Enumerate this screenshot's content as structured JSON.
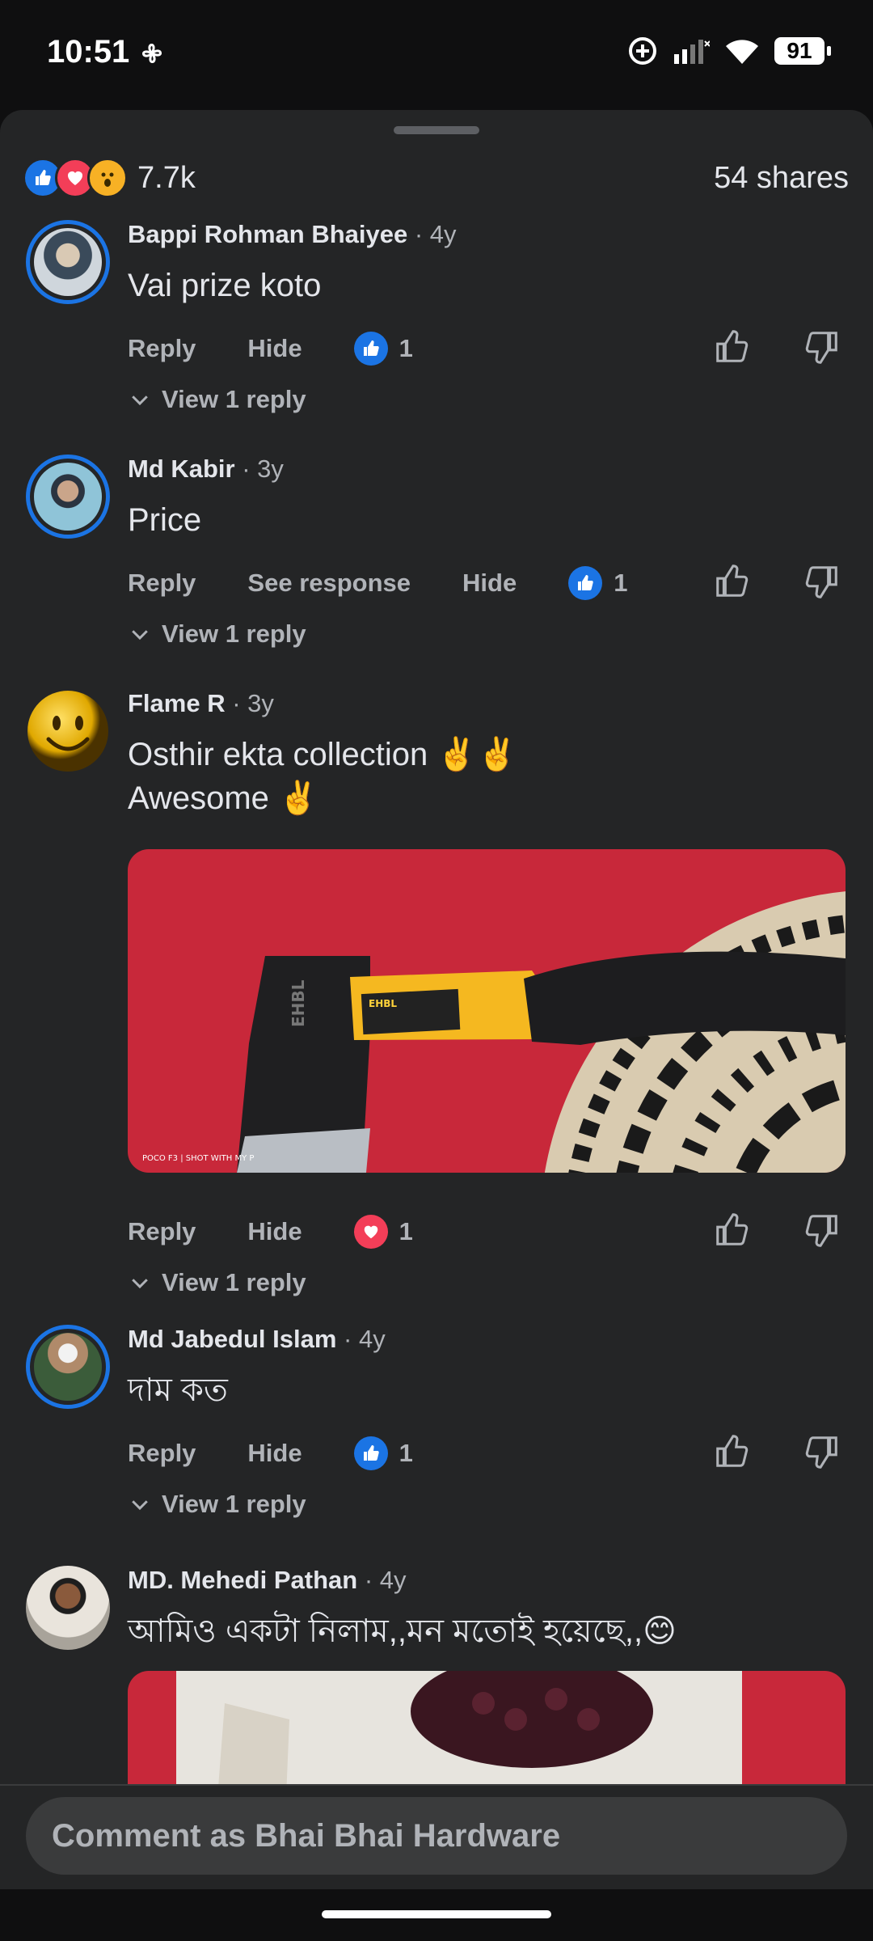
{
  "status_bar": {
    "time": "10:51",
    "battery": "91"
  },
  "summary": {
    "reaction_count": "7.7k",
    "shares": "54 shares",
    "reaction_icons": [
      "like-icon",
      "love-icon",
      "wow-icon"
    ]
  },
  "comments": [
    {
      "name": "Bappi Rohman Bhaiyee",
      "age": "· 4y",
      "text": "Vai prize koto",
      "actions": [
        "Reply",
        "Hide"
      ],
      "reaction": "like",
      "reaction_count": "1",
      "view_replies": "View 1 reply"
    },
    {
      "name": "Md Kabir",
      "age": "· 3y",
      "text": "Price",
      "actions": [
        "Reply",
        "See response",
        "Hide"
      ],
      "reaction": "like",
      "reaction_count": "1",
      "view_replies": "View 1 reply"
    },
    {
      "name": "Flame R",
      "age": "· 3y",
      "text_line1": "Osthir ekta collection ✌️✌️",
      "text_line2": "Awesome ✌️",
      "photo_caption": "POCO F3 | SHOT WITH MY P",
      "axe_brand": "EHBL",
      "actions": [
        "Reply",
        "Hide"
      ],
      "reaction": "love",
      "reaction_count": "1",
      "view_replies": "View 1 reply"
    },
    {
      "name": "Md Jabedul Islam",
      "age": "· 4y",
      "text": "দাম কত",
      "actions": [
        "Reply",
        "Hide"
      ],
      "reaction": "like",
      "reaction_count": "1",
      "view_replies": "View 1 reply"
    },
    {
      "name": "MD. Mehedi Pathan",
      "age": "· 4y",
      "text": "আমিও একটা নিলাম,,মন মতোই হয়েছে,,😊"
    }
  ],
  "composer": {
    "placeholder": "Comment as Bhai Bhai Hardware"
  },
  "colors": {
    "sheet": "#242526",
    "accent_like": "#1b74e4",
    "love": "#f33e58",
    "muted_text": "#b0b3b8"
  }
}
